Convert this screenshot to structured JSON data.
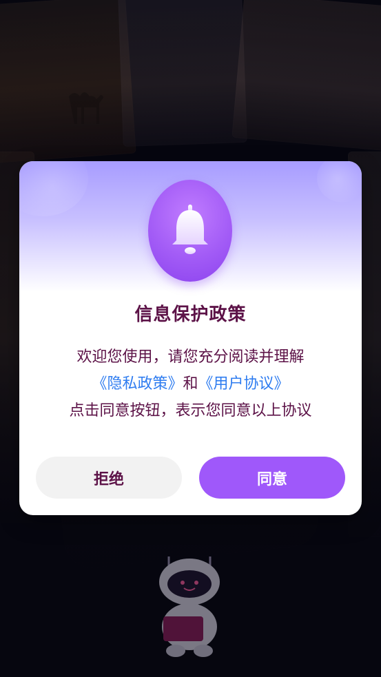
{
  "dialog": {
    "icon": "bell-icon",
    "title": "信息保护政策",
    "line1": "欢迎您使用，请您充分阅读并理解",
    "line2": {
      "privacy_link": "《隐私政策》",
      "and": "和",
      "agreement_link": "《用户协议》"
    },
    "line3": "点击同意按钮，表示您同意以上协议",
    "decline_label": "拒绝",
    "agree_label": "同意"
  },
  "colors": {
    "accent": "#9f58fa",
    "title_text": "#5c1247",
    "link": "#2e7cf0",
    "decline_bg": "#f2f2f2"
  }
}
